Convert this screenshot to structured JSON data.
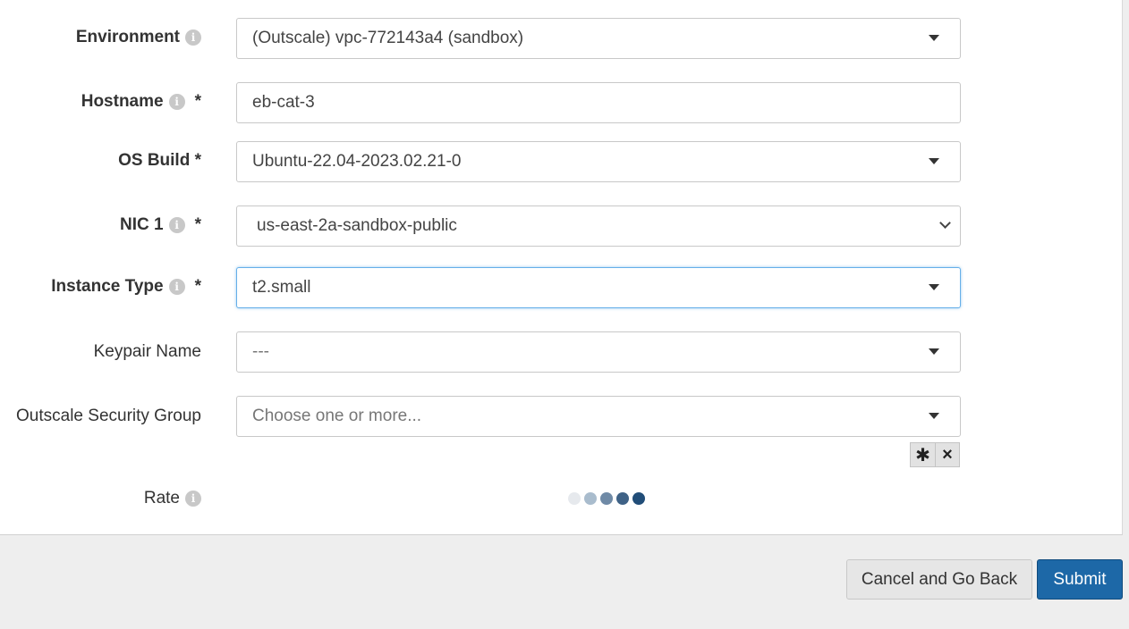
{
  "form": {
    "environment": {
      "label": "Environment",
      "value": "(Outscale) vpc-772143a4 (sandbox)"
    },
    "hostname": {
      "label": "Hostname",
      "required_mark": "*",
      "value": "eb-cat-3"
    },
    "os_build": {
      "label": "OS Build *",
      "value": "Ubuntu-22.04-2023.02.21-0"
    },
    "nic1": {
      "label": "NIC 1",
      "required_mark": "*",
      "value": "us-east-2a-sandbox-public"
    },
    "instance_type": {
      "label": "Instance Type",
      "required_mark": "*",
      "value": "t2.small"
    },
    "keypair_name": {
      "label": "Keypair Name",
      "value": "---"
    },
    "security_group": {
      "label": "Outscale Security Group",
      "placeholder": "Choose one or more...",
      "select_all_glyph": "✱",
      "clear_glyph": "×"
    },
    "rate": {
      "label": "Rate",
      "level": 5,
      "max": 5,
      "dot_colors": [
        "#e6e9ed",
        "#a9bccd",
        "#6f8aa6",
        "#3f6286",
        "#214d78"
      ]
    }
  },
  "info_icon_glyph": "i",
  "actions": {
    "cancel_label": "Cancel and Go Back",
    "submit_label": "Submit"
  },
  "colors": {
    "accent": "#1d68a7",
    "focus_border": "#66afe9"
  }
}
